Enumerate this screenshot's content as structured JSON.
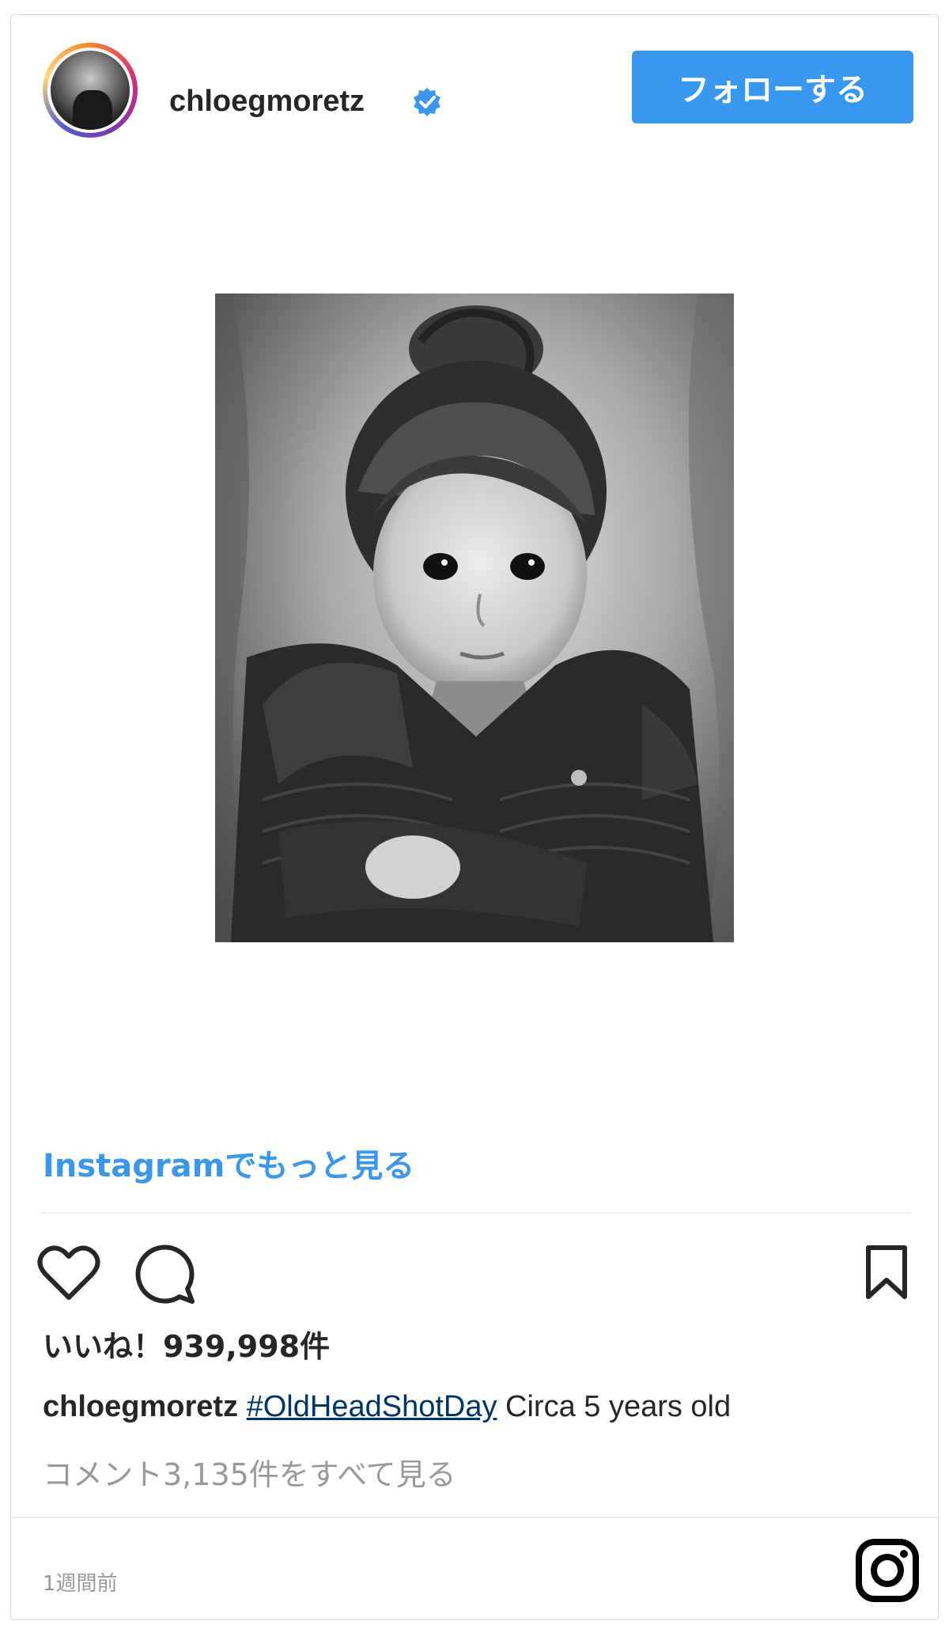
{
  "header": {
    "username": "chloegmoretz",
    "follow_label": "フォローする"
  },
  "more_link": "Instagramでもっと見る",
  "likes_text": "いいね！939,998件",
  "caption": {
    "username": "chloegmoretz",
    "hashtag": "#OldHeadShotDay",
    "text": " Circa 5 years old"
  },
  "view_comments": "コメント3,135件をすべて見る",
  "timestamp": "1週間前",
  "icons": {
    "verified": "verified-badge-icon",
    "like": "heart-icon",
    "comment": "comment-bubble-icon",
    "save": "bookmark-icon",
    "brand": "instagram-logo-icon"
  },
  "colors": {
    "accent": "#3897f0",
    "text": "#262626",
    "muted": "#999999",
    "hashtag": "#003569",
    "border": "#dbdbdb"
  }
}
